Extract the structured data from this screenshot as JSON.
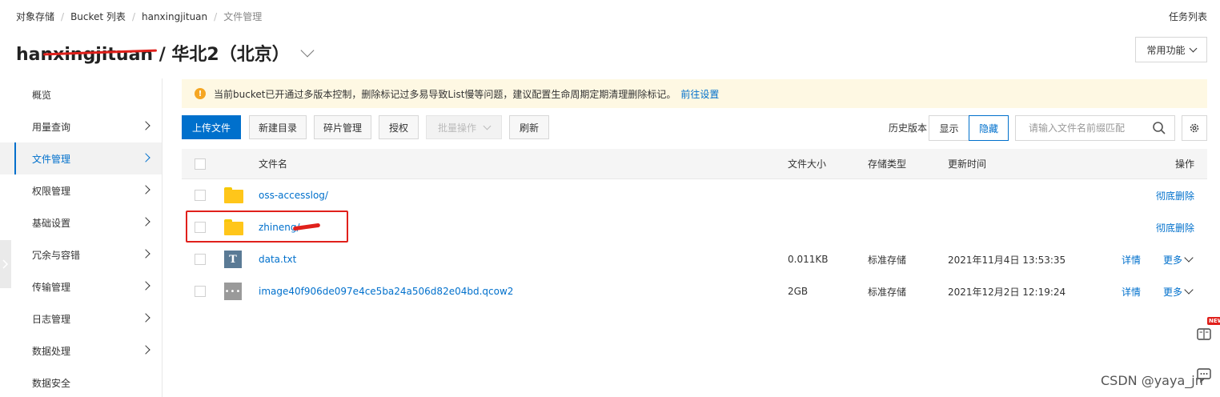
{
  "breadcrumb": [
    "对象存储",
    "Bucket 列表",
    "hanxingjituan",
    "文件管理"
  ],
  "task_list_label": "任务列表",
  "page_title": "hanxingjituan / 华北2（北京）",
  "common_functions_label": "常用功能",
  "sidebar": {
    "items": [
      {
        "label": "概览",
        "chevron": false,
        "active": false
      },
      {
        "label": "用量查询",
        "chevron": true,
        "active": false
      },
      {
        "label": "文件管理",
        "chevron": true,
        "active": true
      },
      {
        "label": "权限管理",
        "chevron": true,
        "active": false
      },
      {
        "label": "基础设置",
        "chevron": true,
        "active": false
      },
      {
        "label": "冗余与容错",
        "chevron": true,
        "active": false
      },
      {
        "label": "传输管理",
        "chevron": true,
        "active": false
      },
      {
        "label": "日志管理",
        "chevron": true,
        "active": false
      },
      {
        "label": "数据处理",
        "chevron": true,
        "active": false
      },
      {
        "label": "数据安全",
        "chevron": false,
        "active": false
      }
    ]
  },
  "notice": {
    "text": "当前bucket已开通过多版本控制，删除标记过多易导致List慢等问题，建议配置生命周期定期清理删除标记。",
    "link": "前往设置"
  },
  "toolbar": {
    "upload": "上传文件",
    "new_dir": "新建目录",
    "fragments": "碎片管理",
    "authorize": "授权",
    "batch": "批量操作",
    "refresh": "刷新",
    "history_label": "历史版本",
    "show": "显示",
    "hide": "隐藏",
    "search_placeholder": "请输入文件名前缀匹配"
  },
  "table": {
    "headers": {
      "name": "文件名",
      "size": "文件大小",
      "storage": "存储类型",
      "updated": "更新时间",
      "actions": "操作"
    },
    "rows": [
      {
        "type": "folder",
        "name": "oss-accesslog/",
        "size": "",
        "storage": "",
        "updated": "",
        "action": "彻底删除"
      },
      {
        "type": "folder",
        "name": "zhineng/",
        "size": "",
        "storage": "",
        "updated": "",
        "action": "彻底删除"
      },
      {
        "type": "txt",
        "name": "data.txt",
        "size": "0.011KB",
        "storage": "标准存储",
        "updated": "2021年11月4日 13:53:35",
        "detail": "详情",
        "more": "更多"
      },
      {
        "type": "image",
        "name": "image40f906de097e4ce5ba24a506d82e04bd.qcow2",
        "size": "2GB",
        "storage": "标准存储",
        "updated": "2021年12月2日 12:19:24",
        "detail": "详情",
        "more": "更多"
      }
    ]
  },
  "new_badge": "NEW",
  "watermark": "CSDN @yaya_jn",
  "colors": {
    "primary": "#0070cc",
    "notice_bg": "#fef8e3",
    "warning": "#f5a623",
    "annotation": "#e0201b"
  }
}
